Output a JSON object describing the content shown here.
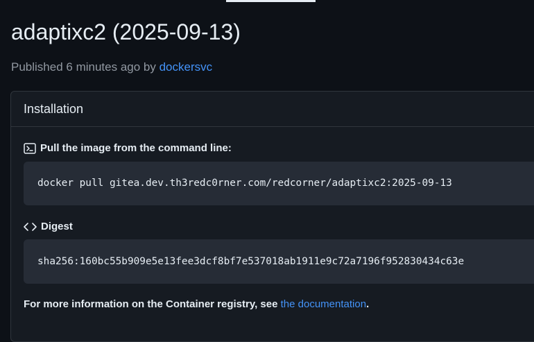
{
  "header": {
    "title": "adaptixc2 (2025-09-13)",
    "published_prefix": "Published 6 minutes ago by",
    "published_by": "dockersvc"
  },
  "installation": {
    "heading": "Installation",
    "pull_label": "Pull the image from the command line:",
    "pull_command": "docker pull gitea.dev.th3redc0rner.com/redcorner/adaptixc2:2025-09-13",
    "digest_label": "Digest",
    "digest_value": "sha256:160bc55b909e5e13fee3dcf8bf7e537018ab1911e9c72a7196f952830434c63e",
    "footer_prefix": "For more information on the Container registry, see",
    "footer_link": "the documentation",
    "footer_suffix": "."
  },
  "icons": {
    "pull": "terminal-icon",
    "digest": "code-icon"
  },
  "colors": {
    "background": "#0d1117",
    "panel": "#161b22",
    "code_bg": "#262c36",
    "link": "#4493f8",
    "muted": "#9198a1"
  }
}
